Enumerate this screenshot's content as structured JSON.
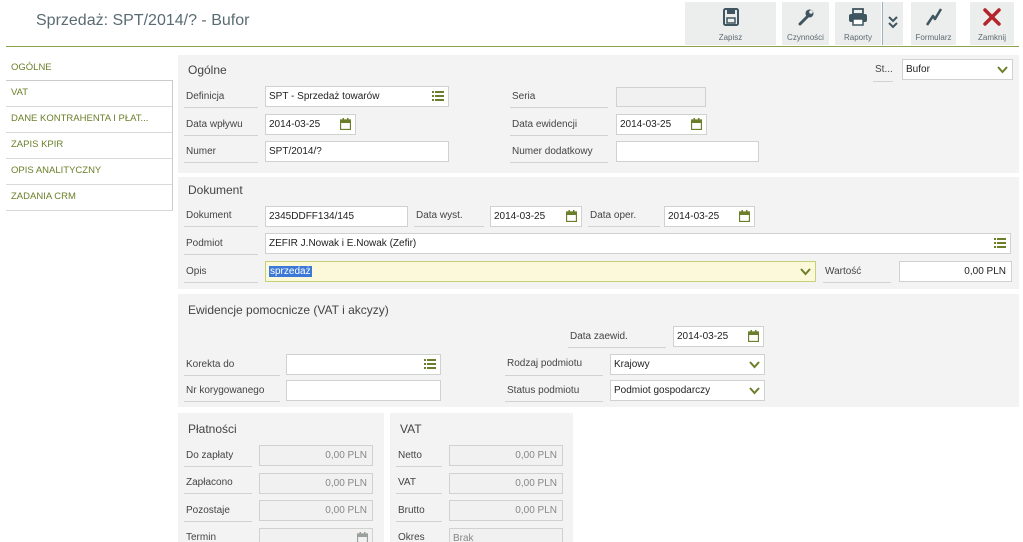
{
  "window": {
    "title": "Sprzedaż: SPT/2014/? - Bufor"
  },
  "toolbar": {
    "save": "Zapisz",
    "actions": "Czynności",
    "reports": "Raporty",
    "form": "Formularz",
    "close": "Zamknij"
  },
  "sidebar": {
    "items": [
      {
        "label": "OGÓLNE"
      },
      {
        "label": "VAT"
      },
      {
        "label": "DANE KONTRAHENTA I PŁAT..."
      },
      {
        "label": "ZAPIS KPIR"
      },
      {
        "label": "OPIS ANALITYCZNY"
      },
      {
        "label": "ZADANIA CRM"
      }
    ]
  },
  "general": {
    "title": "Ogólne",
    "status_label": "St...",
    "status_value": "Bufor",
    "definition_label": "Definicja",
    "definition_value": "SPT - Sprzedaż towarów",
    "series_label": "Seria",
    "series_value": "",
    "received_label": "Data wpływu",
    "received_value": "2014-03-25",
    "record_label": "Data ewidencji",
    "record_value": "2014-03-25",
    "number_label": "Numer",
    "number_value": "SPT/2014/?",
    "extra_number_label": "Numer dodatkowy",
    "extra_number_value": ""
  },
  "document": {
    "title": "Dokument",
    "doc_label": "Dokument",
    "doc_value": "2345DDFF134/145",
    "issued_label": "Data wyst.",
    "issued_value": "2014-03-25",
    "oper_label": "Data oper.",
    "oper_value": "2014-03-25",
    "entity_label": "Podmiot",
    "entity_value": "ZEFIR J.Nowak i E.Nowak (Zefir)",
    "desc_label": "Opis",
    "desc_value": "sprzedaż",
    "value_label": "Wartość",
    "value_value": "0,00 PLN"
  },
  "aux": {
    "title": "Ewidencje pomocnicze (VAT i akcyzy)",
    "reg_date_label": "Data zaewid.",
    "reg_date_value": "2014-03-25",
    "correction_label": "Korekta do",
    "correction_value": "",
    "entity_type_label": "Rodzaj podmiotu",
    "entity_type_value": "Krajowy",
    "corrected_label": "Nr korygowanego",
    "corrected_value": "",
    "entity_status_label": "Status podmiotu",
    "entity_status_value": "Podmiot gospodarczy"
  },
  "payments": {
    "title": "Płatności",
    "to_pay_label": "Do zapłaty",
    "to_pay_value": "0,00 PLN",
    "paid_label": "Zapłacono",
    "paid_value": "0,00 PLN",
    "remaining_label": "Pozostaje",
    "remaining_value": "0,00 PLN",
    "term_label": "Termin",
    "term_value": ""
  },
  "vat": {
    "title": "VAT",
    "net_label": "Netto",
    "net_value": "0,00 PLN",
    "vat_label": "VAT",
    "vat_value": "0,00 PLN",
    "gross_label": "Brutto",
    "gross_value": "0,00 PLN",
    "period_label": "Okres",
    "period_value": "Brak"
  },
  "colors": {
    "accent": "#6b7f2a",
    "close": "#b3262b",
    "icon": "#3f5560"
  }
}
